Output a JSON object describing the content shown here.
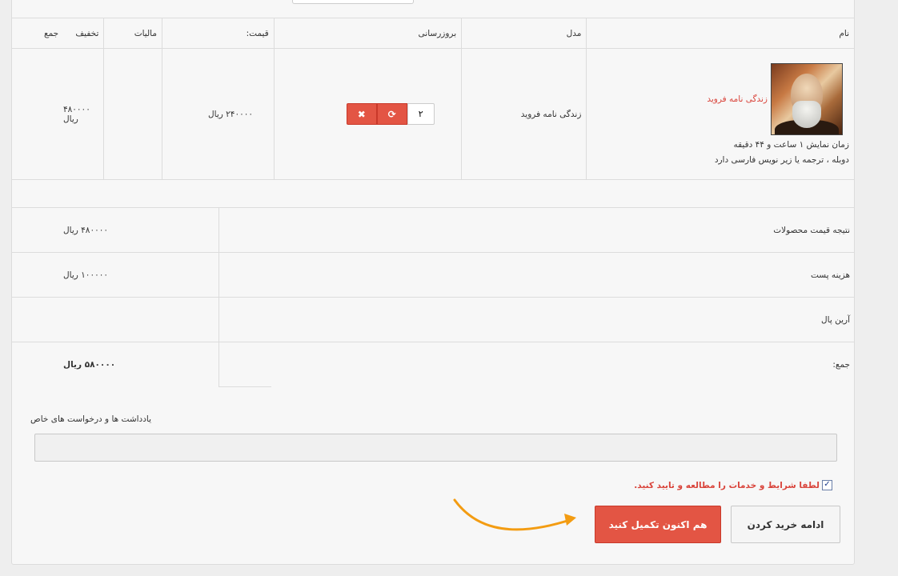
{
  "columns": {
    "name": "نام",
    "model": "مدل",
    "update": "بروزرسانی",
    "price": "قیمت:",
    "tax": "مالیات",
    "discount": "تخفیف",
    "total": "جمع"
  },
  "product": {
    "title": "زندگی نامه فروید",
    "meta_line1": "زمان نمایش ۱ ساعت و ۴۴ دقیقه",
    "meta_line2": "دوبله ، ترجمه یا زیر نویس فارسی دارد",
    "model": "زندگی نامه فروید",
    "quantity": "۲",
    "price": "۲۴۰۰۰۰ ریال",
    "total": "۴۸۰۰۰۰ ریال",
    "image_icon": "product-portrait"
  },
  "totals": [
    {
      "label": "نتیجه قیمت محصولات",
      "value": "۴۸۰۰۰۰ ریال"
    },
    {
      "label": "هزینه پست",
      "value": "۱۰۰۰۰۰ ریال"
    },
    {
      "label": "آرین پال",
      "value": ""
    },
    {
      "label": "جمع:",
      "value": "۵۸۰۰۰۰ ریال"
    }
  ],
  "notes": {
    "label": "یادداشت ها و درخواست های خاص",
    "value": ""
  },
  "terms": {
    "checked": true,
    "text": "لطفا شرایط و خدمات را مطالعه و تایید کنید."
  },
  "buttons": {
    "continue": "ادامه خرید کردن",
    "checkout": "هم اکنون تکمیل کنید"
  },
  "colors": {
    "accent_red": "#e35544",
    "link_red": "#d9433a",
    "annotation_arrow": "#f39c12"
  }
}
